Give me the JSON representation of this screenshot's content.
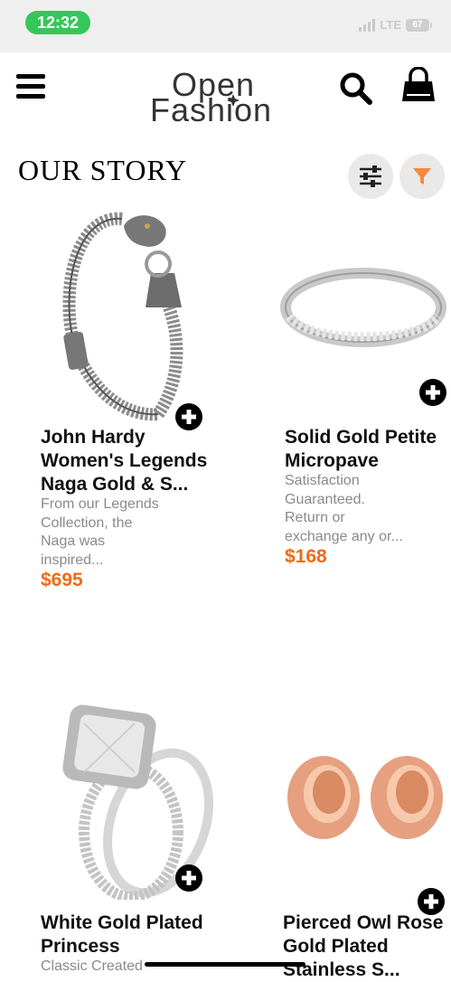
{
  "status_bar": {
    "time": "12:32",
    "network": "LTE",
    "battery": "67"
  },
  "header": {
    "logo_line1": "Open",
    "logo_line2": "Fashion"
  },
  "section": {
    "title": "OUR STORY"
  },
  "products": [
    {
      "title_line1": "John Hardy",
      "title_line2": "Women's Legends",
      "title_line3": "Naga Gold & S...",
      "desc_line1": "From our Legends",
      "desc_line2": "Collection, the",
      "desc_line3": "Naga was",
      "desc_line4": "inspired...",
      "price": "$695"
    },
    {
      "title_line1": "Solid Gold Petite",
      "title_line2": "Micropave",
      "desc_line1": "Satisfaction",
      "desc_line2": "Guaranteed.",
      "desc_line3": "Return or",
      "desc_line4": "exchange any or...",
      "price": "$168"
    },
    {
      "title_line1": "White Gold Plated",
      "title_line2": "Princess",
      "desc_line1": "Classic Created"
    },
    {
      "title_line1": "Pierced Owl Rose",
      "title_line2": "Gold Plated",
      "title_line3": "Stainless S..."
    }
  ],
  "colors": {
    "price": "#f06a12",
    "filter_accent": "#f58a3c",
    "time_pill": "#34c759"
  }
}
